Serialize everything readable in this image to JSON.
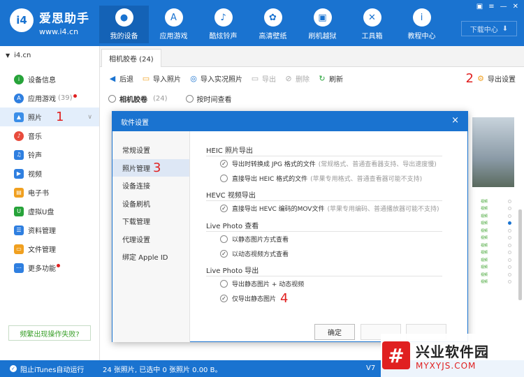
{
  "app": {
    "name": "爱思助手",
    "url": "www.i4.cn",
    "logo": "i4",
    "download_center": "下载中心"
  },
  "nav": [
    {
      "label": "我的设备",
      "icon": "apple-icon",
      "glyph": ""
    },
    {
      "label": "应用游戏",
      "icon": "appstore-icon",
      "glyph": "A"
    },
    {
      "label": "酷炫铃声",
      "icon": "bell-icon",
      "glyph": "♪"
    },
    {
      "label": "高清壁纸",
      "icon": "flower-icon",
      "glyph": "✿"
    },
    {
      "label": "刷机越狱",
      "icon": "box-icon",
      "glyph": "▣"
    },
    {
      "label": "工具箱",
      "icon": "tools-icon",
      "glyph": "✕"
    },
    {
      "label": "教程中心",
      "icon": "info-icon",
      "glyph": "i"
    }
  ],
  "sidebar": {
    "device": "i4.cn",
    "items": [
      {
        "label": "设备信息",
        "icon": "info-icon",
        "color": "#27a33a"
      },
      {
        "label": "应用游戏",
        "count": "(39)",
        "icon": "appstore-icon",
        "color": "#2f7fe0",
        "dot": true
      },
      {
        "label": "照片",
        "icon": "photo-icon",
        "color": "#3b8ee8",
        "annotation": "1"
      },
      {
        "label": "音乐",
        "icon": "music-icon",
        "color": "#e84c3d"
      },
      {
        "label": "铃声",
        "icon": "bell-icon",
        "color": "#2f7fe0"
      },
      {
        "label": "视频",
        "icon": "video-icon",
        "color": "#2f7fe0"
      },
      {
        "label": "电子书",
        "icon": "book-icon",
        "color": "#f0a020"
      },
      {
        "label": "虚拟U盘",
        "icon": "usb-icon",
        "color": "#27a33a"
      },
      {
        "label": "资料管理",
        "icon": "contacts-icon",
        "color": "#2f7fe0"
      },
      {
        "label": "文件管理",
        "icon": "folder-icon",
        "color": "#f0a020"
      },
      {
        "label": "更多功能",
        "icon": "more-icon",
        "color": "#2f7fe0",
        "dot": true
      }
    ],
    "help_button": "频繁出现操作失败?"
  },
  "tab": {
    "label": "相机胶卷 (24)"
  },
  "toolbar": {
    "back": "后退",
    "import_photo": "导入照片",
    "import_live": "导入实况照片",
    "export": "导出",
    "delete": "删除",
    "refresh": "刷新",
    "export_settings": "导出设置",
    "annotation": "2"
  },
  "filter": {
    "camera_roll": "相机胶卷",
    "count": "(24)",
    "by_time": "按时间查看"
  },
  "bg_list": [
    "视频",
    "视频",
    "视频",
    "视频",
    "视频",
    "视频",
    "视频",
    "视频",
    "视频",
    "视频",
    "视频",
    "视频"
  ],
  "statusbar": {
    "itunes": "阻止iTunes自动运行",
    "info": "24 张照片, 已选中 0 张照片 0.00 B。",
    "version": "V7"
  },
  "dialog": {
    "title": "软件设置",
    "close": "×",
    "nav": [
      {
        "label": "常规设置"
      },
      {
        "label": "照片管理",
        "annotation": "3"
      },
      {
        "label": "设备连接"
      },
      {
        "label": "设备刷机"
      },
      {
        "label": "下载管理"
      },
      {
        "label": "代理设置"
      },
      {
        "label": "绑定 Apple ID"
      }
    ],
    "sections": [
      {
        "title": "HEIC 照片导出",
        "options": [
          {
            "label": "导出时转换成 JPG 格式的文件",
            "hint": "(常规格式、普通查看器支持、导出速度慢)",
            "checked": true
          },
          {
            "label": "直接导出 HEIC 格式的文件",
            "hint": "(苹果专用格式、普通查看器可能不支持)",
            "checked": false
          }
        ]
      },
      {
        "title": "HEVC 视频导出",
        "options": [
          {
            "label": "直接导出 HEVC 编码的MOV文件",
            "hint": "(苹果专用编码、普通播放器可能不支持)",
            "checked": true
          }
        ]
      },
      {
        "title": "Live Photo 查看",
        "options": [
          {
            "label": "以静态图片方式查看",
            "hint": "",
            "checked": false
          },
          {
            "label": "以动态视频方式查看",
            "hint": "",
            "checked": true
          }
        ]
      },
      {
        "title": "Live Photo 导出",
        "options": [
          {
            "label": "导出静态图片 + 动态视频",
            "hint": "",
            "checked": false
          },
          {
            "label": "仅导出静态图片",
            "hint": "",
            "checked": true,
            "annotation": "4"
          }
        ]
      }
    ],
    "ok": "确定"
  },
  "watermark": {
    "name": "兴业软件园",
    "url": "MYXYJS.COM",
    "logo": "#"
  }
}
